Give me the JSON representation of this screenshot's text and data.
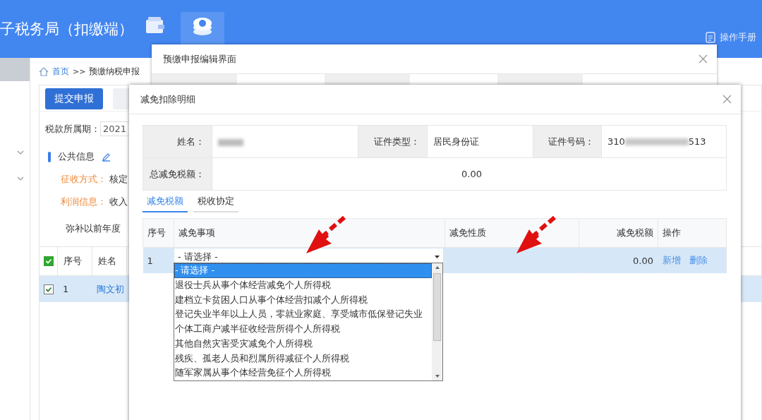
{
  "app_title": "子税务局（扣缴端）",
  "header_link": "操作手册",
  "breadcrumb": {
    "home": "首页",
    "separator": ">>",
    "current": "预缴纳税申报"
  },
  "submit_button": "提交申报",
  "period": {
    "label": "税款所属期：",
    "value": "2021"
  },
  "section_title": "公共信息",
  "info_lines": [
    {
      "label": "征收方式：",
      "value": "核定"
    },
    {
      "label": "利润信息：",
      "value": "收入"
    }
  ],
  "note": "弥补以前年度",
  "table": {
    "all_checked": true,
    "columns": [
      "序号",
      "姓名"
    ],
    "rows": [
      {
        "checked": true,
        "selected": true,
        "cells": [
          "1",
          "陶文初"
        ]
      }
    ]
  },
  "edit_dialog": {
    "title": "预缴申报编辑界面"
  },
  "deduction_dialog": {
    "title": "减免扣除明细",
    "name_label": "姓名：",
    "id_type_label": "证件类型：",
    "id_type": "居民身份证",
    "id_number_label": "证件号码：",
    "id_number_start": "310",
    "id_number_end": "513",
    "total_label": "总减免税额：",
    "total": "0.00",
    "tabs": [
      {
        "label": "减免税额",
        "selected": true
      },
      {
        "label": "税收协定",
        "selected": false
      }
    ],
    "grid": {
      "columns": [
        "序号",
        "减免事项",
        "减免性质",
        "减免税额",
        "操作"
      ],
      "rows": [
        {
          "index": "1",
          "item": "- 请选择 -",
          "amount": "0.00",
          "selected": true,
          "actions": [
            "新增",
            "删除"
          ]
        }
      ]
    },
    "dropdown": {
      "options": [
        {
          "label": "- 请选择 -",
          "selected": true
        },
        {
          "label": "退役士兵从事个体经营减免个人所得税",
          "selected": false
        },
        {
          "label": "建档立卡贫困人口从事个体经营扣减个人所得税",
          "selected": false
        },
        {
          "label": "登记失业半年以上人员，零就业家庭、享受城市低保登记失业",
          "selected": false
        },
        {
          "label": "个体工商户减半征收经营所得个人所得税",
          "selected": false
        },
        {
          "label": "其他自然灾害受灾减免个人所得税",
          "selected": false
        },
        {
          "label": "残疾、孤老人员和烈属所得减征个人所得税",
          "selected": false
        },
        {
          "label": "随军家属从事个体经营免征个人所得税",
          "selected": false
        }
      ]
    }
  }
}
